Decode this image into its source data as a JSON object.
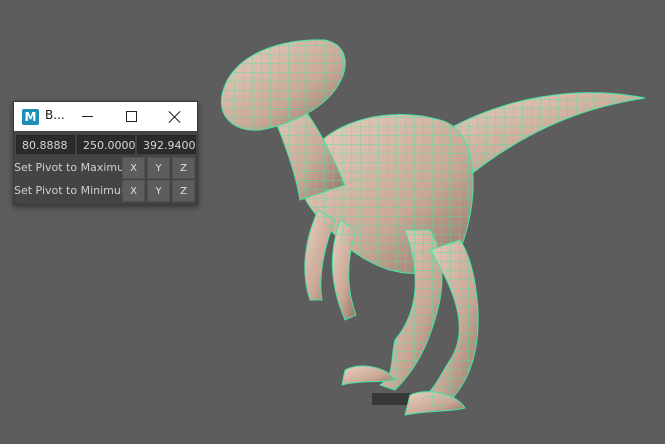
{
  "window": {
    "title": "B...",
    "app_icon_letter": "M"
  },
  "fields": {
    "x_value": "80.8888",
    "y_value": "250.0000",
    "z_value": "392.9400"
  },
  "rows": [
    {
      "label": "Set Pivot to Maximum",
      "buttons": [
        "X",
        "Y",
        "Z"
      ]
    },
    {
      "label": "Set Pivot to Minimum",
      "buttons": [
        "X",
        "Y",
        "Z"
      ]
    }
  ],
  "viewport": {
    "background": "#5d5d5d",
    "model_color": "#d6b8a4",
    "wire_color": "#46e3a3"
  }
}
